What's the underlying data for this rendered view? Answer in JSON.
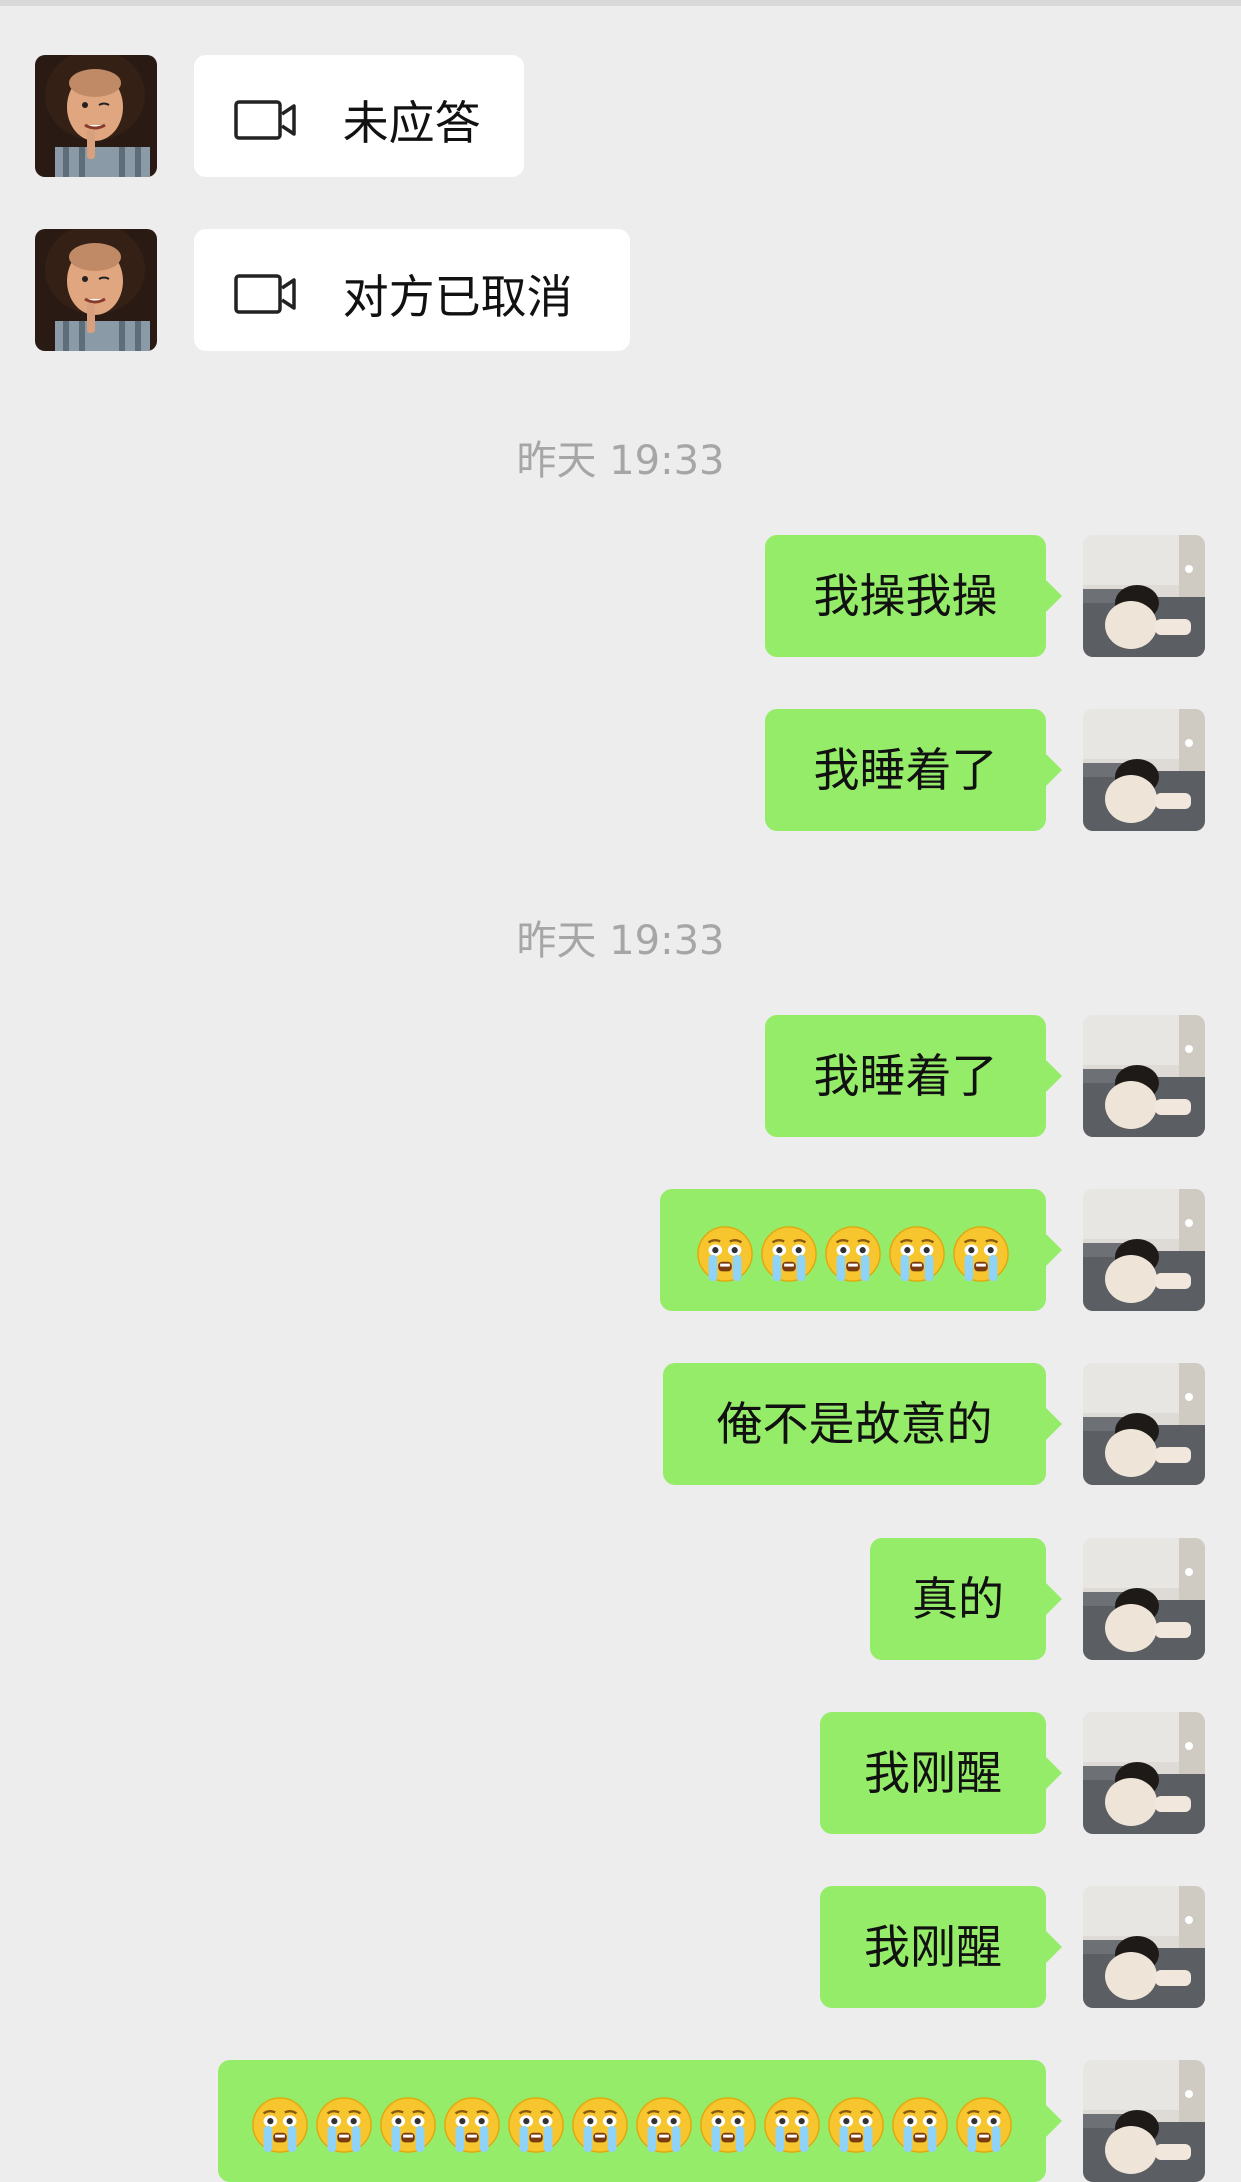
{
  "calls": [
    {
      "label": "未应答",
      "icon": "video-call-icon"
    },
    {
      "label": "对方已取消",
      "icon": "video-call-icon"
    }
  ],
  "timestamps": [
    "昨天 19:33",
    "昨天 19:33"
  ],
  "messages": [
    {
      "text": "我操我操"
    },
    {
      "text": "我睡着了"
    },
    {
      "text": "我睡着了"
    },
    {
      "emoji": "crying-face-emoji",
      "count": 5
    },
    {
      "text": "俺不是故意的"
    },
    {
      "text": "真的"
    },
    {
      "text": "我刚醒"
    },
    {
      "text": "我刚醒"
    },
    {
      "emoji": "crying-face-emoji",
      "count": 12
    }
  ],
  "colors": {
    "background": "#ededed",
    "sent_bubble": "#95ec69",
    "received_bubble": "#ffffff",
    "timestamp": "#a6a6a6"
  }
}
